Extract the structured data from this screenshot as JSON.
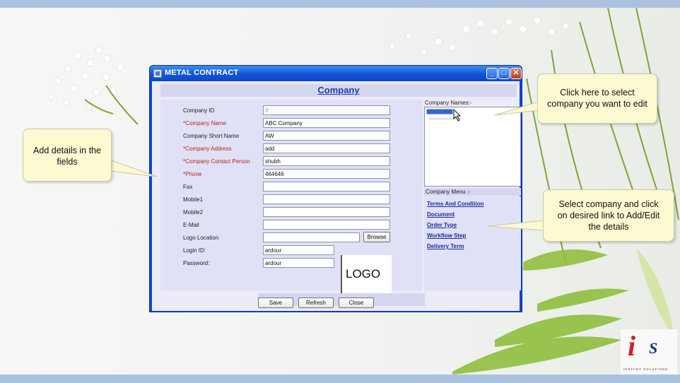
{
  "window": {
    "title": "METAL CONTRACT",
    "min_glyph": "_",
    "max_glyph": "□",
    "close_glyph": "✕"
  },
  "form": {
    "title": "Company",
    "fields": [
      {
        "label": "Company ID",
        "value": "3",
        "required": false
      },
      {
        "label": "*Company Name",
        "value": "ABC Company",
        "required": true
      },
      {
        "label": "Company Short Name",
        "value": "AW",
        "required": false
      },
      {
        "label": "*Company Address",
        "value": "add",
        "required": true
      },
      {
        "label": "*Company Contact Person",
        "value": "shubh",
        "required": true
      },
      {
        "label": "*Phone",
        "value": "464646",
        "required": true
      },
      {
        "label": "Fax",
        "value": "",
        "required": false
      },
      {
        "label": "Mobile1",
        "value": "",
        "required": false
      },
      {
        "label": "Mobile2",
        "value": "",
        "required": false
      },
      {
        "label": "E-Mail",
        "value": "",
        "required": false
      },
      {
        "label": "Logo Location",
        "value": "",
        "required": false
      },
      {
        "label": "Login ID:",
        "value": "ardour",
        "required": false
      },
      {
        "label": "Password:",
        "value": "ardour",
        "required": false
      }
    ],
    "browse_label": "Browse",
    "logo_text": "LOGO"
  },
  "company_names": {
    "label": "Company Names:-"
  },
  "company_menu": {
    "label": "Company Menu :-",
    "links": [
      "Terms And Condition",
      "Document",
      "Order Type",
      "Workflow Step",
      "Delivery Term"
    ]
  },
  "buttons": {
    "save": "Save",
    "refresh": "Refresh",
    "close": "Close"
  },
  "callouts": {
    "left": [
      "Add details in the",
      "fields"
    ],
    "top_right": [
      "Click here to select",
      "company you want to edit"
    ],
    "bottom_right": [
      "Select company and click",
      "on desired link to Add/Edit",
      "the details"
    ]
  },
  "brand": {
    "mark": "i",
    "mark_s": "S",
    "tagline": "INSTANT SOLUTIONS"
  },
  "colors": {
    "titlebar": "#1054d8",
    "required_label": "#b32424",
    "link": "#1a2d9b",
    "callout_fill": "#fdfad2",
    "slide_band": "#aac2de"
  }
}
